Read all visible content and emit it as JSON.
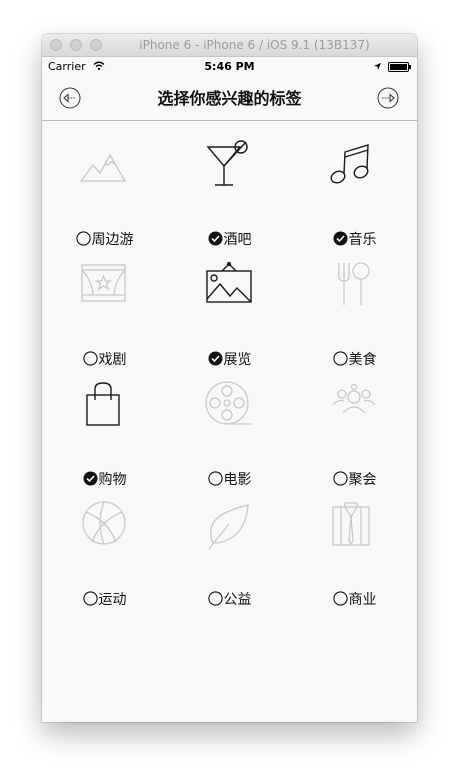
{
  "simulator": {
    "title": "iPhone 6 - iPhone 6 / iOS 9.1 (13B137)"
  },
  "statusbar": {
    "carrier": "Carrier",
    "time": "5:46 PM"
  },
  "navbar": {
    "title": "选择你感兴趣的标签",
    "back_icon": "arrow-left-circle-icon",
    "forward_icon": "arrow-right-circle-icon"
  },
  "tags": [
    {
      "label": "周边游",
      "icon": "mountains-icon",
      "selected": false
    },
    {
      "label": "酒吧",
      "icon": "cocktail-icon",
      "selected": true
    },
    {
      "label": "音乐",
      "icon": "music-note-icon",
      "selected": true
    },
    {
      "label": "戏剧",
      "icon": "theater-stage-icon",
      "selected": false
    },
    {
      "label": "展览",
      "icon": "picture-frame-icon",
      "selected": true
    },
    {
      "label": "美食",
      "icon": "fork-spoon-icon",
      "selected": false
    },
    {
      "label": "购物",
      "icon": "shopping-bag-icon",
      "selected": true
    },
    {
      "label": "电影",
      "icon": "film-reel-icon",
      "selected": false
    },
    {
      "label": "聚会",
      "icon": "people-group-icon",
      "selected": false
    },
    {
      "label": "运动",
      "icon": "basketball-icon",
      "selected": false
    },
    {
      "label": "公益",
      "icon": "leaf-icon",
      "selected": false
    },
    {
      "label": "商业",
      "icon": "shirt-tie-icon",
      "selected": false
    }
  ],
  "colors": {
    "icon_active": "#1a1a1a",
    "icon_inactive": "#c8c8c8",
    "background": "#f8f8f8"
  }
}
